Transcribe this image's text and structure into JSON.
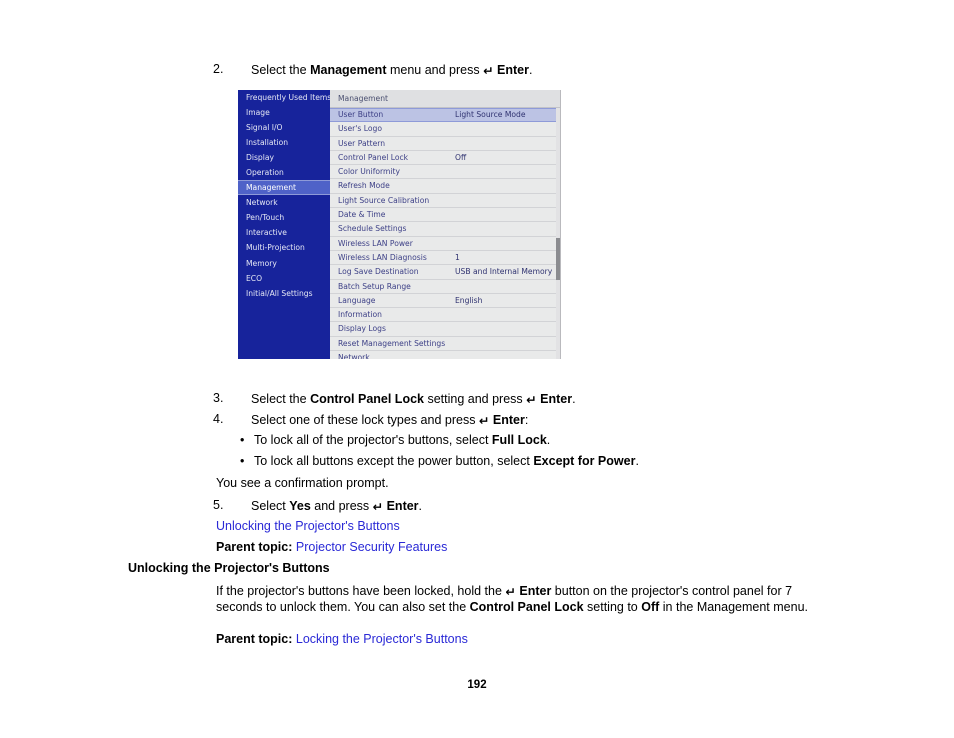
{
  "document": {
    "page_number": "192",
    "enter_glyph": "↵"
  },
  "steps": {
    "step2": {
      "number": "2.",
      "before": "Select the ",
      "bold1": "Management",
      "middle": " menu and press ",
      "enter": "Enter",
      "after": "."
    },
    "step3": {
      "number": "3.",
      "before": "Select the ",
      "bold1": "Control Panel Lock",
      "middle": " setting and press ",
      "enter": "Enter",
      "after": "."
    },
    "step4": {
      "number": "4.",
      "before": "Select one of these lock types and press ",
      "enter": "Enter",
      "after": ":"
    },
    "step5": {
      "number": "5.",
      "before": "Select ",
      "bold1": "Yes",
      "middle": " and press ",
      "enter": "Enter",
      "after": "."
    }
  },
  "bullets": [
    {
      "marker": "•",
      "before": "To lock all of the projector's buttons, select ",
      "bold": "Full Lock",
      "after": "."
    },
    {
      "marker": "•",
      "before": "To lock all buttons except the power button, select ",
      "bold": "Except for Power",
      "after": "."
    }
  ],
  "confirmation_text": "You see a confirmation prompt.",
  "cross_reference_link": "Unlocking the Projector's Buttons",
  "parent_topic_1": {
    "label": "Parent topic:",
    "link": "Projector Security Features"
  },
  "section": {
    "heading": "Unlocking the Projector's Buttons",
    "body_part1": "If the projector's buttons have been locked, hold the ",
    "body_enter": "Enter",
    "body_part2": " button on the projector's control panel for 7 seconds to unlock them. You can also set the ",
    "body_bold_control": "Control Panel Lock",
    "body_part3": " setting to ",
    "body_bold_off": "Off",
    "body_part4": " in the Management menu."
  },
  "parent_topic_2": {
    "label": "Parent topic:",
    "link": "Locking the Projector's Buttons"
  },
  "osd": {
    "panel_title": "Management",
    "sidebar": [
      {
        "label": "Frequently Used Items",
        "selected": false
      },
      {
        "label": "Image",
        "selected": false
      },
      {
        "label": "Signal I/O",
        "selected": false
      },
      {
        "label": "Installation",
        "selected": false
      },
      {
        "label": "Display",
        "selected": false
      },
      {
        "label": "Operation",
        "selected": false
      },
      {
        "label": "Management",
        "selected": true
      },
      {
        "label": "Network",
        "selected": false
      },
      {
        "label": "Pen/Touch",
        "selected": false
      },
      {
        "label": "Interactive",
        "selected": false
      },
      {
        "label": "Multi-Projection",
        "selected": false
      },
      {
        "label": "Memory",
        "selected": false
      },
      {
        "label": "ECO",
        "selected": false
      },
      {
        "label": "Initial/All Settings",
        "selected": false
      }
    ],
    "rows": [
      {
        "label": "User Button",
        "value": "Light Source Mode",
        "selected": true
      },
      {
        "label": "User's Logo",
        "value": "",
        "selected": false
      },
      {
        "label": "User Pattern",
        "value": "",
        "selected": false
      },
      {
        "label": "Control Panel Lock",
        "value": "Off",
        "selected": false
      },
      {
        "label": "Color Uniformity",
        "value": "",
        "selected": false
      },
      {
        "label": "Refresh Mode",
        "value": "",
        "selected": false
      },
      {
        "label": "Light Source Calibration",
        "value": "",
        "selected": false
      },
      {
        "label": "Date & Time",
        "value": "",
        "selected": false
      },
      {
        "label": "Schedule Settings",
        "value": "",
        "selected": false
      },
      {
        "label": "Wireless LAN Power",
        "value": "",
        "selected": false
      },
      {
        "label": "Wireless LAN Diagnosis",
        "value": "1",
        "selected": false
      },
      {
        "label": "Log Save Destination",
        "value": "USB and Internal Memory",
        "selected": false
      },
      {
        "label": "Batch Setup Range",
        "value": "",
        "selected": false
      },
      {
        "label": "Language",
        "value": "English",
        "selected": false
      },
      {
        "label": "Information",
        "value": "",
        "selected": false
      },
      {
        "label": "Display Logs",
        "value": "",
        "selected": false
      },
      {
        "label": "Reset Management Settings",
        "value": "",
        "selected": false
      },
      {
        "label": "Network",
        "value": "",
        "selected": false
      }
    ],
    "colors": {
      "sidebar_bg": "#17239b",
      "sidebar_selected": "#4f62c8",
      "panel_bg": "#e9eaea",
      "row_selected": "#bcc3e4",
      "label_text": "#3c3f86"
    }
  }
}
